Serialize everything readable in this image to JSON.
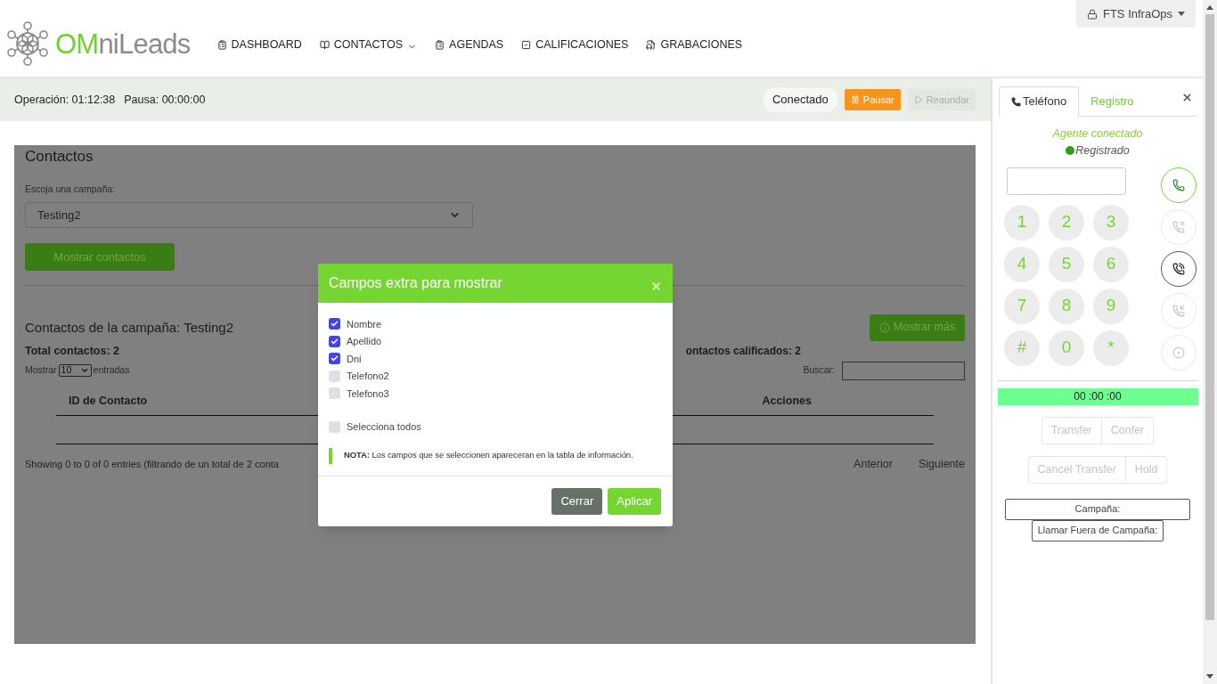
{
  "header": {
    "logo": {
      "part_1": "OM",
      "part_2": "niLeads"
    },
    "nav": [
      {
        "label": "DASHBOARD",
        "kind": "clipboard",
        "dropdown": false
      },
      {
        "label": "CONTACTOS",
        "kind": "book",
        "dropdown": true
      },
      {
        "label": "AGENDAS",
        "kind": "clipboard",
        "dropdown": false
      },
      {
        "label": "CALIFICACIONES",
        "kind": "check",
        "dropdown": false
      },
      {
        "label": "GRABACIONES",
        "kind": "audio",
        "dropdown": false
      }
    ],
    "user_menu": {
      "label": "FTS InfraOps"
    }
  },
  "status_bar": {
    "operation": "Operación: 01:12:38",
    "pause": "Pausa: 00:00:00",
    "connection": "Conectado",
    "buttons": [
      {
        "label": "Pausar",
        "kind": "pause",
        "disabled": false
      },
      {
        "label": "Reaundar",
        "kind": "resume",
        "disabled": true
      }
    ]
  },
  "contacts": {
    "title": "Contactos",
    "campaign_label": "Escoja una campaña:",
    "campaign_value": "Testing2",
    "show_button": "Mostrar contactos",
    "subtitle": "Contactos de la campaña: Testing2",
    "more_button": "Mostrar más",
    "total": "Total contactos: 2",
    "qualified": "ontactos calificados: 2",
    "page_size": {
      "prefix": "Mostrar",
      "value": "10",
      "suffix": "entradas"
    },
    "search_label": "Buscar:",
    "table": {
      "columns": [
        "ID de Contacto",
        "Acciones"
      ]
    },
    "info": "Showing 0 to 0 of 0 entries (filtrando de un total de 2 conta",
    "pager": [
      "Anterior",
      "Siguiente"
    ]
  },
  "modal": {
    "title": "Campos extra para mostrar",
    "fields": [
      {
        "label": "Nombre",
        "checked": true
      },
      {
        "label": "Apellido",
        "checked": true
      },
      {
        "label": "Dni",
        "checked": true
      },
      {
        "label": "Telefono2",
        "checked": false
      },
      {
        "label": "Telefono3",
        "checked": false
      }
    ],
    "select_all": {
      "label": "Selecciona todos",
      "checked": false
    },
    "note": "**NOTA:** Los campos que se seleccionen apareceran en la tabla de información.",
    "buttons": [
      {
        "label": "Cerrar",
        "kind": "secondary"
      },
      {
        "label": "Aplicar",
        "kind": "primary"
      }
    ]
  },
  "phone": {
    "tabs": [
      {
        "label": "Teléfono",
        "selected": true
      },
      {
        "label": "Registro",
        "selected": false
      }
    ],
    "agent_status": "Agente conectado",
    "registration": "Registrado",
    "keys": [
      "1",
      "2",
      "3",
      "4",
      "5",
      "6",
      "7",
      "8",
      "9",
      "#",
      "0",
      "*"
    ],
    "actions": [
      {
        "kind": "call",
        "disabled": false
      },
      {
        "kind": "hangup",
        "disabled": true
      },
      {
        "kind": "transfer",
        "disabled": false
      },
      {
        "kind": "add",
        "disabled": true
      },
      {
        "kind": "record",
        "disabled": true
      }
    ],
    "timer": "00 :00 :00",
    "button_groups": [
      [
        {
          "label": "Transfer",
          "disabled": true
        },
        {
          "label": "Confer",
          "disabled": true
        }
      ],
      [
        {
          "label": "Cancel Transfer",
          "disabled": true
        },
        {
          "label": "Hold",
          "disabled": true
        }
      ]
    ],
    "campaign": "Campaña:",
    "outside_call": "Llamar Fuera de Campaña:"
  }
}
